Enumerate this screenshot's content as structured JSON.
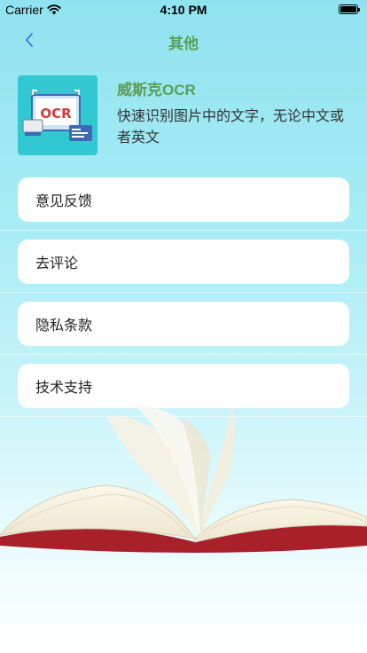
{
  "status_bar": {
    "carrier": "Carrier",
    "time": "4:10 PM",
    "icons": [
      "wifi-icon",
      "battery-icon"
    ]
  },
  "nav": {
    "back_icon": "chevron-left-icon",
    "title": "其他",
    "accent_color": "#5a9e57",
    "back_color": "#3a86d8"
  },
  "app": {
    "name": "威斯克OCR",
    "description": "快速识别图片中的文字，无论中文或者英文",
    "icon_label": "OCR",
    "icon_color": "#32c8d2"
  },
  "menu": {
    "items": [
      {
        "label": "意见反馈"
      },
      {
        "label": "去评论"
      },
      {
        "label": "隐私条款"
      },
      {
        "label": "技术支持"
      }
    ]
  },
  "background": {
    "gradient_top": "#8fe3f0",
    "gradient_bottom": "#ffffff",
    "illustration": "open-book-illustration"
  }
}
